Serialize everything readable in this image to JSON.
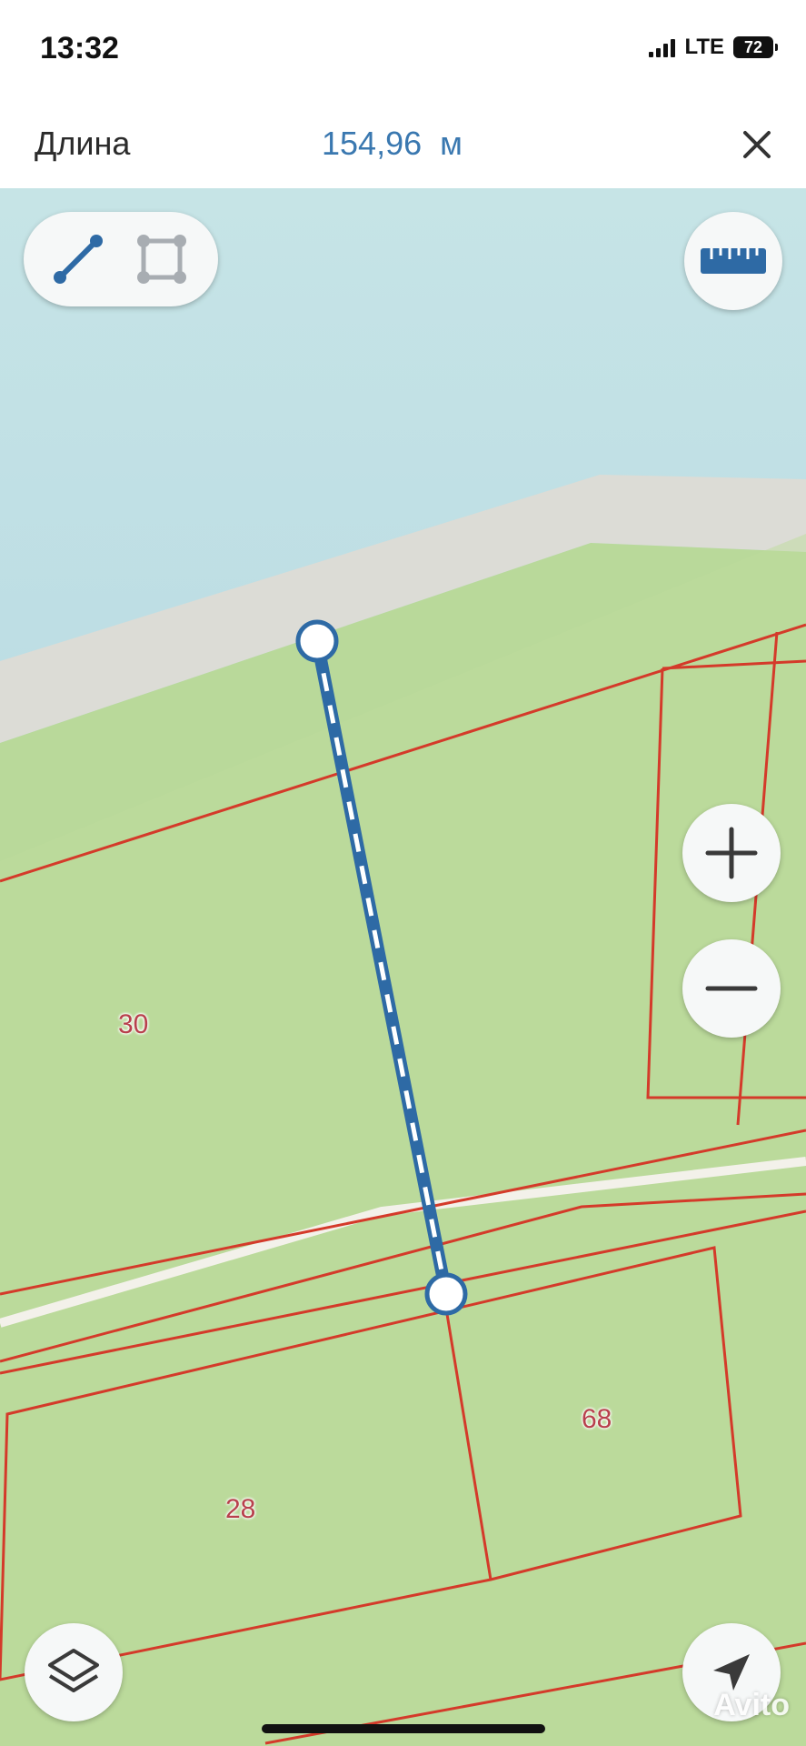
{
  "status_bar": {
    "time": "13:32",
    "network": "LTE",
    "battery": "72"
  },
  "measure": {
    "label": "Длина",
    "value": "154,96",
    "unit": "м"
  },
  "parcels": [
    {
      "number": "30"
    },
    {
      "number": "68"
    },
    {
      "number": "28"
    }
  ],
  "icons": {
    "close": "close-icon",
    "line_mode": "line-measure-icon",
    "area_mode": "area-measure-icon",
    "ruler": "ruler-icon",
    "zoom_in": "plus-icon",
    "zoom_out": "minus-icon",
    "layers": "layers-icon",
    "location": "location-arrow-icon"
  },
  "colors": {
    "water": "#bcdde3",
    "shore": "#dcdcd6",
    "land": "#b9d99a",
    "parcel_border": "#d43a2a",
    "measure_line": "#2e6aa5",
    "accent_text": "#3a78b0"
  },
  "watermark": "Avito"
}
